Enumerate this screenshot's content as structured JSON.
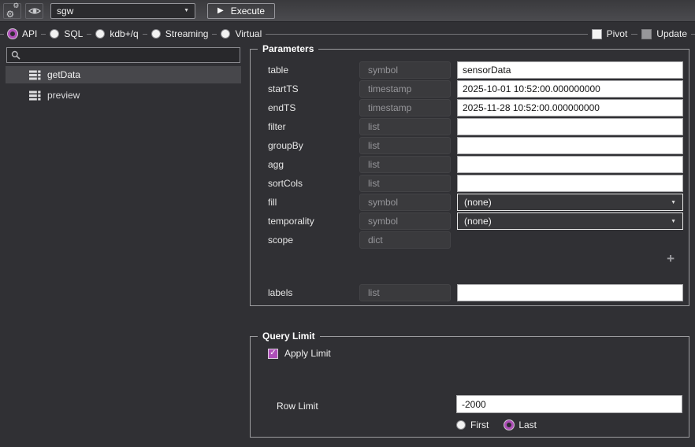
{
  "colors": {
    "accent": "#ae4fb8",
    "panel_border": "#9d9da0",
    "background": "#303034"
  },
  "icons": {
    "plus_glyph": "+",
    "caret_glyph": "▼",
    "play_glyph": "▶",
    "check_glyph": "✓",
    "gear_glyph": "⚙"
  },
  "toolbar": {
    "connection_value": "sgw",
    "execute_label": "Execute"
  },
  "query_types": [
    {
      "label": "API",
      "selected": true
    },
    {
      "label": "SQL",
      "selected": false
    },
    {
      "label": "kdb+/q",
      "selected": false
    },
    {
      "label": "Streaming",
      "selected": false
    },
    {
      "label": "Virtual",
      "selected": false
    }
  ],
  "view_flags": [
    {
      "label": "Pivot",
      "checked": false,
      "variant": "normal"
    },
    {
      "label": "Update",
      "checked": false,
      "variant": "disabled"
    }
  ],
  "sidebar": {
    "search_value": "",
    "items": [
      {
        "label": "getData",
        "selected": true
      },
      {
        "label": "preview",
        "selected": false
      }
    ]
  },
  "parameters": {
    "title": "Parameters",
    "rows": [
      {
        "name": "table",
        "type": "symbol",
        "control": "text",
        "value": "sensorData"
      },
      {
        "name": "startTS",
        "type": "timestamp",
        "control": "text",
        "value": "2025-10-01 10:52:00.000000000"
      },
      {
        "name": "endTS",
        "type": "timestamp",
        "control": "text",
        "value": "2025-11-28 10:52:00.000000000"
      },
      {
        "name": "filter",
        "type": "list",
        "control": "text",
        "value": ""
      },
      {
        "name": "groupBy",
        "type": "list",
        "control": "text",
        "value": ""
      },
      {
        "name": "agg",
        "type": "list",
        "control": "text",
        "value": ""
      },
      {
        "name": "sortCols",
        "type": "list",
        "control": "text",
        "value": ""
      },
      {
        "name": "fill",
        "type": "symbol",
        "control": "select",
        "value": "(none)"
      },
      {
        "name": "temporality",
        "type": "symbol",
        "control": "select",
        "value": "(none)"
      },
      {
        "name": "scope",
        "type": "dict",
        "control": "none",
        "value": ""
      },
      {
        "name": "labels",
        "type": "list",
        "control": "text",
        "value": ""
      }
    ]
  },
  "query_limit": {
    "title": "Query Limit",
    "apply_limit_label": "Apply Limit",
    "apply_limit_checked": true,
    "row_limit_label": "Row Limit",
    "row_limit_value": "-2000",
    "order_options": [
      {
        "label": "First",
        "selected": false
      },
      {
        "label": "Last",
        "selected": true
      }
    ]
  }
}
